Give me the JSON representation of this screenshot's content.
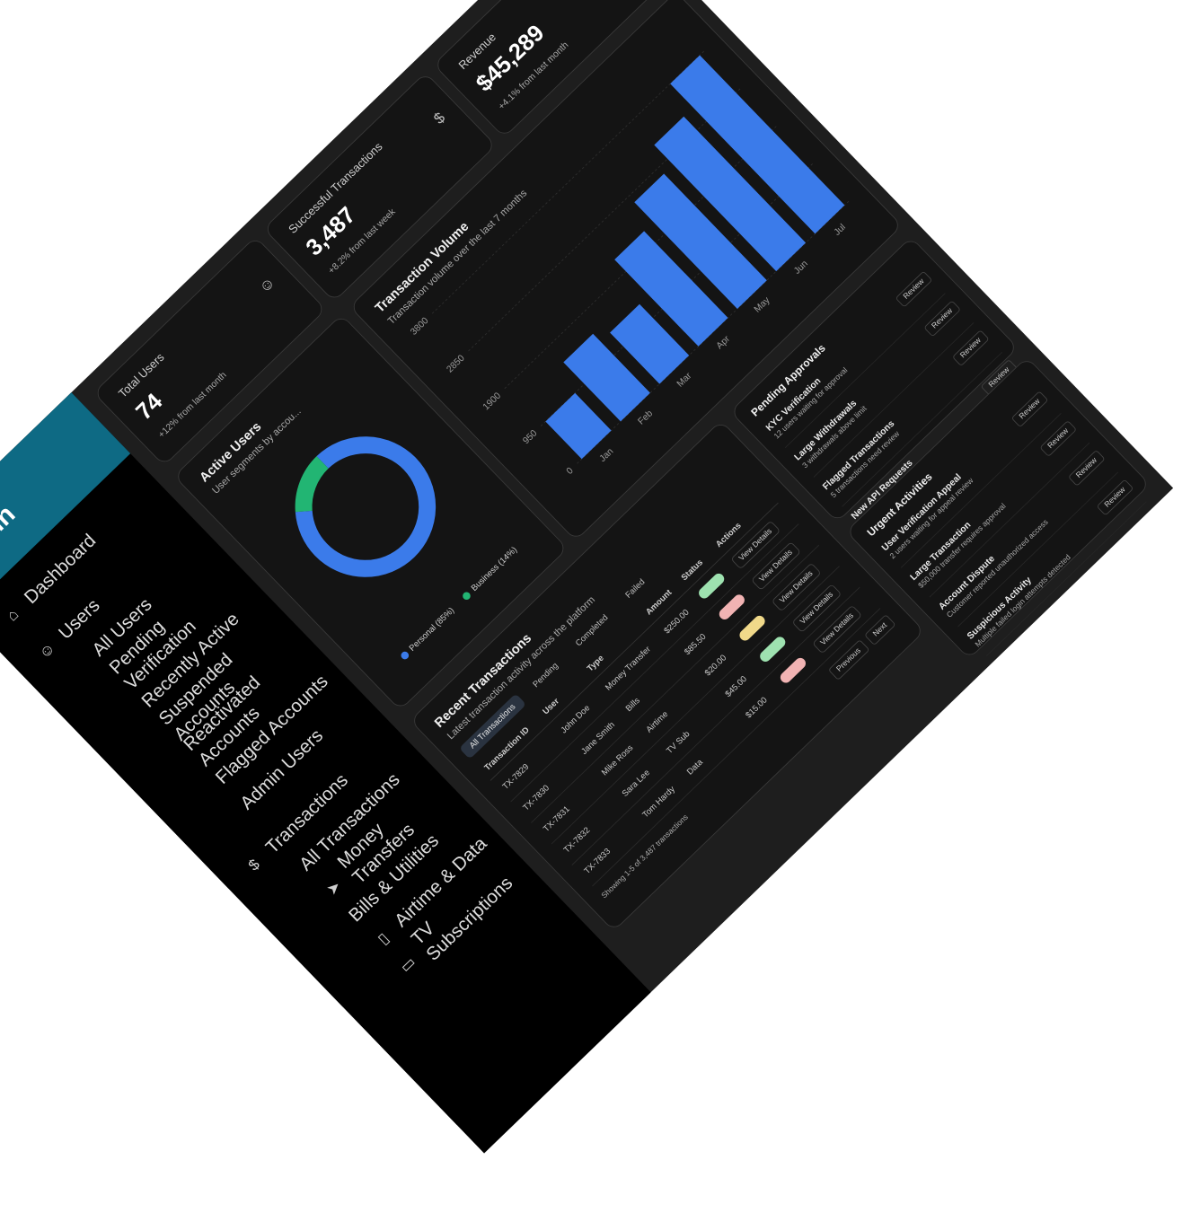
{
  "brand": {
    "title": "Admin"
  },
  "sidebar": {
    "dashboard": "Dashboard",
    "users": "Users",
    "user_items": [
      "All Users",
      "Pending Verification",
      "Recently Active",
      "Suspended Accounts",
      "Reactivated Accounts",
      "Flagged Accounts",
      "Admin Users"
    ],
    "transactions": "Transactions",
    "transaction_items": [
      "All Transactions",
      "Money Transfers",
      "Bills & Utilities",
      "Airtime & Data",
      "TV Subscriptions"
    ]
  },
  "stats": [
    {
      "title": "Total Users",
      "value": "74",
      "delta": "+12% from last month",
      "icon": "users-icon"
    },
    {
      "title": "Successful Transactions",
      "value": "3,487",
      "delta": "+8.2% from last week",
      "icon": "dollar-icon"
    },
    {
      "title": "Revenue",
      "value": "$45,289",
      "delta": "+4.1% from last month",
      "icon": "coins-icon"
    }
  ],
  "donut": {
    "title": "Active Users",
    "subtitle": "User segments by accou...",
    "legend": [
      "Personal (85%)",
      "Business (14%)"
    ],
    "colors": {
      "personal": "#3b7bea",
      "business": "#22b573"
    }
  },
  "volume_chart": {
    "title": "Transaction Volume",
    "subtitle": "Transaction volume over the last 7 months",
    "bar_color": "#3b7bea"
  },
  "chart_data": {
    "type": "bar",
    "categories": [
      "Jan",
      "Feb",
      "Mar",
      "Apr",
      "May",
      "Jun",
      "Jul"
    ],
    "values": [
      950,
      1500,
      1300,
      2200,
      2700,
      3200,
      3800
    ],
    "yticks": [
      "0",
      "950",
      "1900",
      "2850",
      "3800"
    ],
    "ylim": [
      0,
      3800
    ],
    "xlabel": "",
    "ylabel": ""
  },
  "recent_transactions": {
    "title": "Recent Transactions",
    "subtitle": "Latest transaction activity across the platform",
    "filters": [
      "All Transactions",
      "Pending",
      "Completed",
      "Failed"
    ],
    "columns": [
      "Transaction ID",
      "User",
      "Type",
      "Amount",
      "Status",
      "Actions"
    ],
    "rows": [
      {
        "id": "TX-7829",
        "user": "John Doe",
        "type": "Money Transfer",
        "amount": "$250.00",
        "status_color": "#9ee2b0"
      },
      {
        "id": "TX-7830",
        "user": "Jane Smith",
        "type": "Bills",
        "amount": "$85.50",
        "status_color": "#f1b3b3"
      },
      {
        "id": "TX-7831",
        "user": "Mike Ross",
        "type": "Airtime",
        "amount": "$20.00",
        "status_color": "#f0d98a"
      },
      {
        "id": "TX-7832",
        "user": "Sara Lee",
        "type": "TV Sub",
        "amount": "$45.00",
        "status_color": "#9ee2b0"
      },
      {
        "id": "TX-7833",
        "user": "Tom Hardy",
        "type": "Data",
        "amount": "$15.00",
        "status_color": "#f1b3b3"
      }
    ],
    "action_label": "View Details",
    "showing": "Showing 1-5 of 3,487 transactions",
    "pager": [
      "Previous",
      "Next"
    ]
  },
  "pending_approvals": {
    "title": "Pending Approvals",
    "items": [
      {
        "title": "KYC Verification",
        "desc": "12 users waiting for approval",
        "action": "Review"
      },
      {
        "title": "Large Withdrawals",
        "desc": "3 withdrawals above limit",
        "action": "Review"
      },
      {
        "title": "Flagged Transactions",
        "desc": "5 transactions need review",
        "action": "Review"
      },
      {
        "title": "New API Requests",
        "desc": "2 merchants requesting API access",
        "action": "Review"
      }
    ]
  },
  "urgent_activities": {
    "title": "Urgent Activities",
    "items": [
      {
        "title": "User Verification Appeal",
        "desc": "2 users waiting for appeal review",
        "action": "Review"
      },
      {
        "title": "Large Transaction",
        "desc": "$50,000 transfer requires approval",
        "action": "Review"
      },
      {
        "title": "Account Dispute",
        "desc": "Customer reported unauthorized access",
        "action": "Review"
      },
      {
        "title": "Suspicious Activity",
        "desc": "Multiple failed login attempts detected",
        "action": "Review"
      }
    ]
  }
}
